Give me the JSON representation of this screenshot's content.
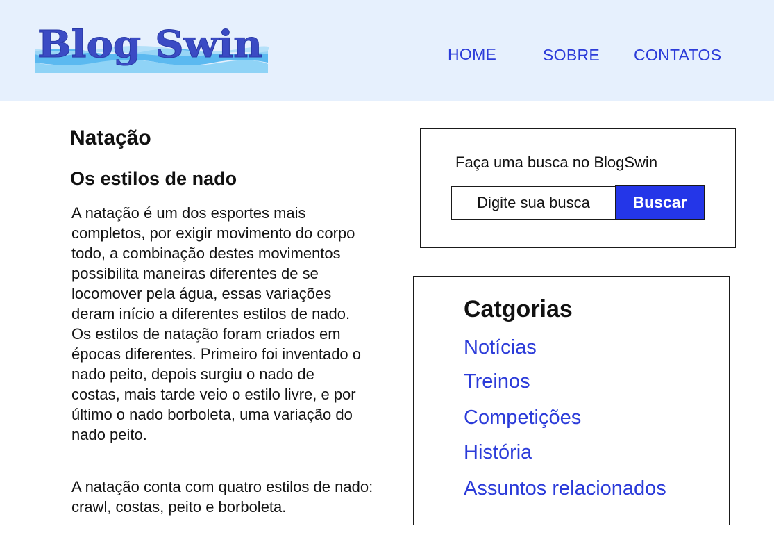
{
  "header": {
    "logo_text": "Blog Swin",
    "nav": [
      {
        "label": "HOME"
      },
      {
        "label": "SOBRE"
      },
      {
        "label": "CONTATOS"
      }
    ]
  },
  "article": {
    "title": "Natação",
    "subtitle": "Os estilos de nado",
    "paragraphs": [
      "A natação é um dos esportes mais completos, por exigir movimento do corpo todo, a combinação destes movimentos possibilita maneiras diferentes de se locomover pela água, essas variações deram início a diferentes estilos de nado. Os estilos de natação foram criados em épocas diferentes. Primeiro foi inventado o nado peito, depois surgiu o nado de costas, mais tarde veio o estilo livre, e por último o nado borboleta, uma variação do nado peito.",
      "A natação conta com quatro estilos de nado: crawl, costas, peito e borboleta."
    ]
  },
  "search": {
    "label": "Faça uma busca no BlogSwin",
    "placeholder": "Digite sua busca",
    "button_label": "Buscar"
  },
  "categories": {
    "title": "Catgorias",
    "items": [
      {
        "label": "Notícias"
      },
      {
        "label": "Treinos"
      },
      {
        "label": "Competições"
      },
      {
        "label": "História"
      },
      {
        "label": "Assuntos relacionados"
      }
    ]
  },
  "colors": {
    "header_bg": "#e6f0fd",
    "link": "#2b3bd9",
    "button_bg": "#2436e8",
    "logo_text": "#3b4bc4",
    "logo_waves": "#5bb9f0"
  }
}
